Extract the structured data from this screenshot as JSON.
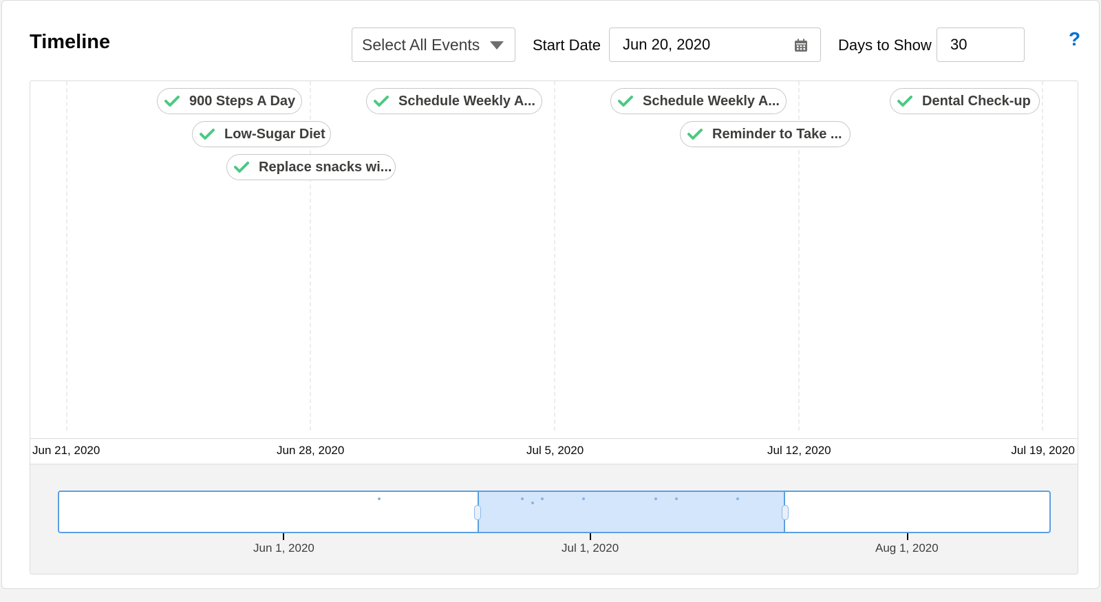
{
  "header": {
    "title": "Timeline",
    "event_filter": "Select All Events",
    "start_date_label": "Start Date",
    "start_date_value": "Jun 20, 2020",
    "days_label": "Days to Show",
    "days_value": "30",
    "help": "?"
  },
  "colors": {
    "check": "#4bca81",
    "accent": "#0070d2",
    "navigator_fill": "#d4e6fb",
    "navigator_border": "#5b9fe0"
  },
  "events": [
    {
      "label": "900 Steps A Day"
    },
    {
      "label": "Low-Sugar Diet"
    },
    {
      "label": "Replace snacks wi..."
    },
    {
      "label": "Schedule Weekly A..."
    },
    {
      "label": "Schedule Weekly A..."
    },
    {
      "label": "Reminder to Take ..."
    },
    {
      "label": "Dental Check-up"
    }
  ],
  "axis": {
    "ticks": [
      "Jun 21, 2020",
      "Jun 28, 2020",
      "Jul 5, 2020",
      "Jul 12, 2020",
      "Jul 19, 2020"
    ]
  },
  "navigator": {
    "ticks": [
      "Jun 1, 2020",
      "Jul 1, 2020",
      "Aug 1, 2020"
    ],
    "window_start": "Jun 20, 2020",
    "window_end": "Jul 19, 2020"
  }
}
